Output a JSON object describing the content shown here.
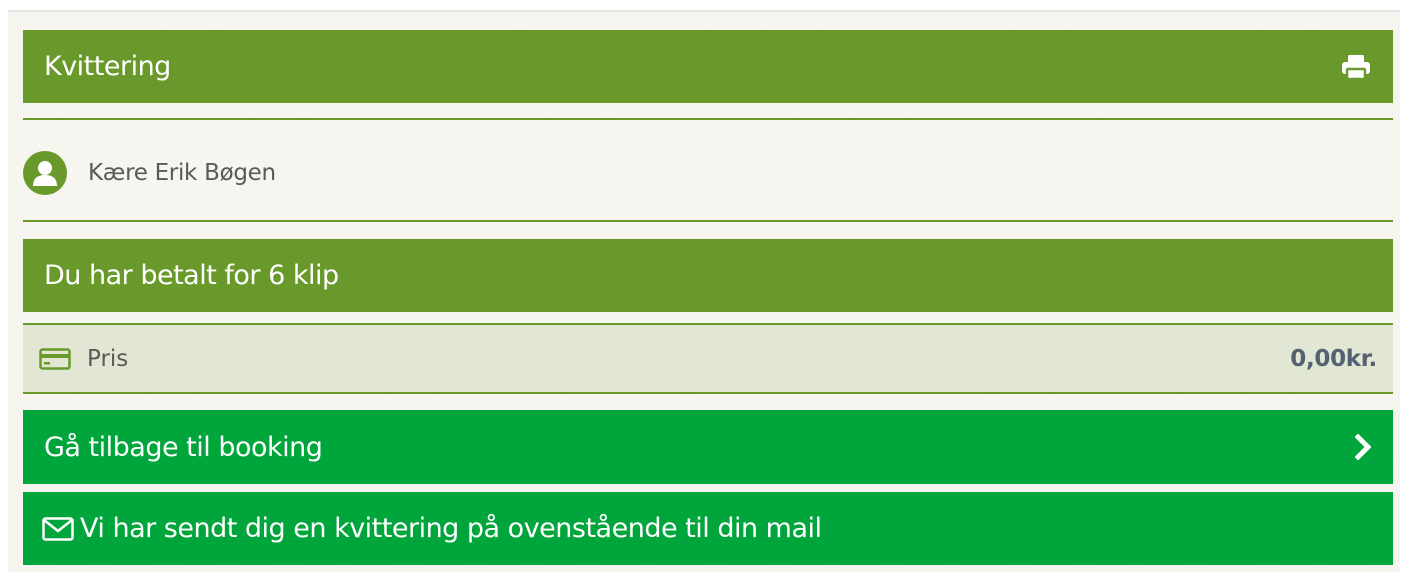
{
  "header": {
    "title": "Kvittering",
    "print_icon": "printer-icon"
  },
  "greeting": {
    "icon": "user-circle-icon",
    "text": "Kære Erik Bøgen"
  },
  "purchase": {
    "title": "Du har betalt for 6 klip"
  },
  "price": {
    "icon": "credit-card-icon",
    "label": "Pris",
    "value": "0,00kr."
  },
  "actions": {
    "back_label": "Gå tilbage til booking",
    "back_icon": "chevron-right-icon"
  },
  "notice": {
    "icon": "envelope-icon",
    "text": "Vi har sendt dig en kvittering på ovenstående til din mail"
  },
  "colors": {
    "olive": "#68992a",
    "green": "#00a63b",
    "price_bg": "#e2e7d3",
    "page_bg": "#f8f6f0"
  }
}
